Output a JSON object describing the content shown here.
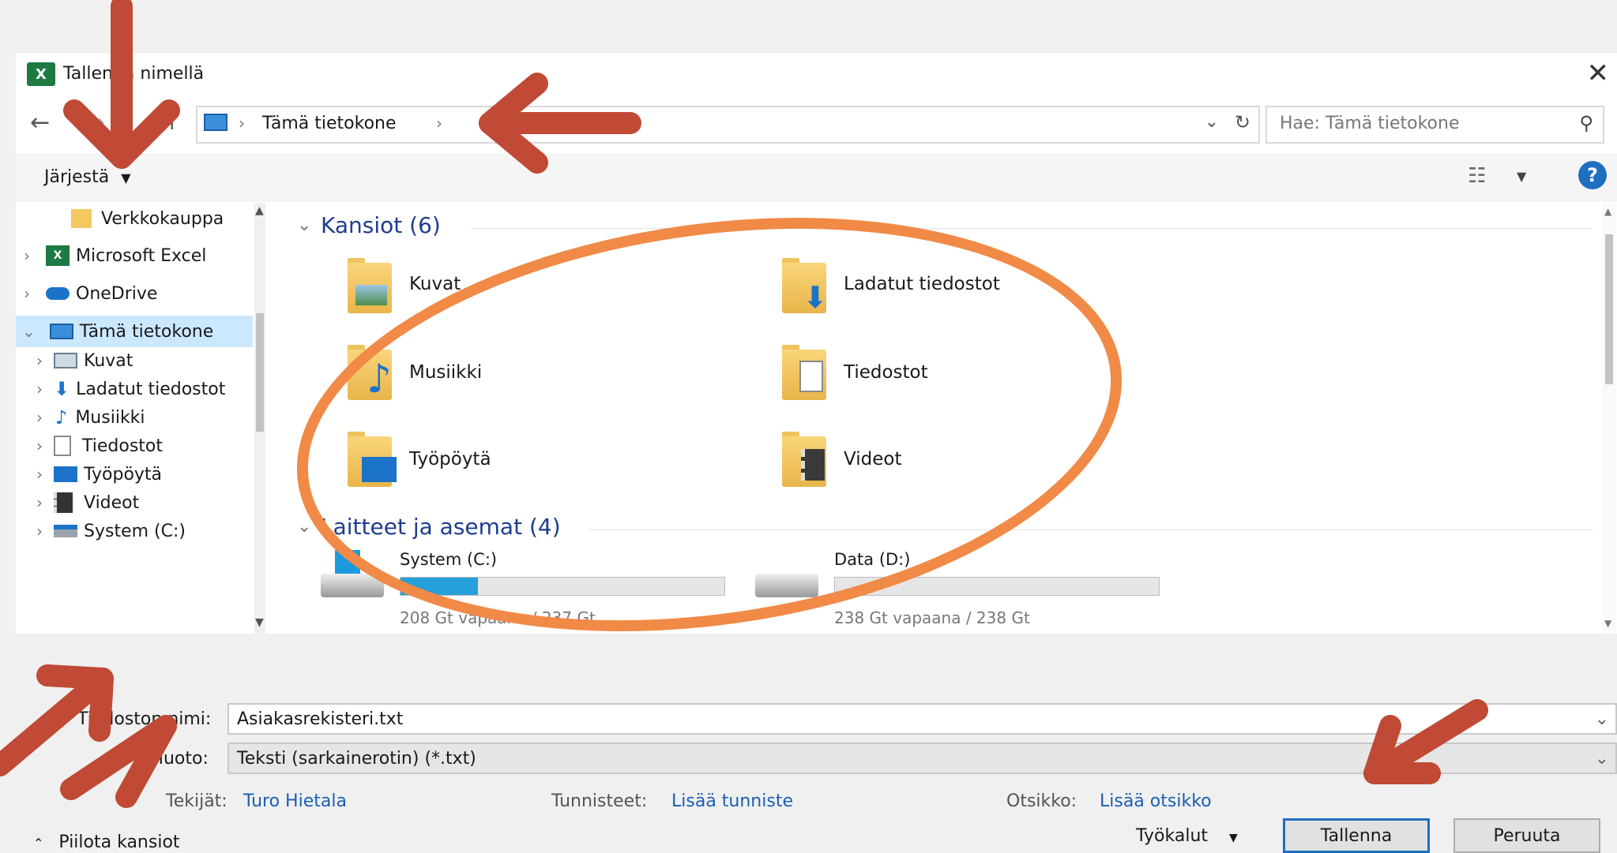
{
  "window": {
    "title": "Tallenna nimellä"
  },
  "address": {
    "path": "Tämä tietokone",
    "search_placeholder": "Hae: Tämä tietokone"
  },
  "toolbar": {
    "organize": "Järjestä"
  },
  "nav": [
    {
      "label": "Verkkokauppa",
      "icon": "folder-icon"
    },
    {
      "label": "Microsoft Excel",
      "icon": "excel-icon"
    },
    {
      "label": "OneDrive",
      "icon": "cloud-icon"
    },
    {
      "label": "Tämä tietokone",
      "icon": "computer-icon"
    },
    {
      "label": "Kuvat",
      "icon": "pictures-icon"
    },
    {
      "label": "Ladatut tiedostot",
      "icon": "download-icon"
    },
    {
      "label": "Musiikki",
      "icon": "music-icon"
    },
    {
      "label": "Tiedostot",
      "icon": "documents-icon"
    },
    {
      "label": "Työpöytä",
      "icon": "desktop-icon"
    },
    {
      "label": "Videot",
      "icon": "video-icon"
    },
    {
      "label": "System (C:)",
      "icon": "drive-icon"
    }
  ],
  "content": {
    "folders_header": "Kansiot (6)",
    "folders": [
      {
        "label": "Kuvat"
      },
      {
        "label": "Ladatut tiedostot"
      },
      {
        "label": "Musiikki"
      },
      {
        "label": "Tiedostot"
      },
      {
        "label": "Työpöytä"
      },
      {
        "label": "Videot"
      }
    ],
    "drives_header": "Laitteet ja asemat (4)",
    "drives": [
      {
        "label": "System (C:)",
        "space": "208 Gt vapaana / 237 Gt",
        "used_fraction": 0.24
      },
      {
        "label": "Data (D:)",
        "space": "238 Gt vapaana / 238 Gt",
        "used_fraction": 0.0
      }
    ]
  },
  "form": {
    "filename_label": "Tiedoston nimi:",
    "filename_value": "Asiakasrekisteri.txt",
    "format_label": "Muoto:",
    "format_value": "Teksti (sarkainerotin) (*.txt)",
    "authors_label": "Tekijät:",
    "authors_value": "Turo Hietala",
    "tags_label": "Tunnisteet:",
    "tags_value": "Lisää tunniste",
    "title_label": "Otsikko:",
    "title_value": "Lisää otsikko"
  },
  "footer": {
    "hide_folders": "Piilota kansiot",
    "tools": "Työkalut",
    "save": "Tallenna",
    "cancel": "Peruuta"
  },
  "colors": {
    "accent": "#1e6fbf",
    "arrow": "#c04a35",
    "oval": "#f08a46"
  }
}
